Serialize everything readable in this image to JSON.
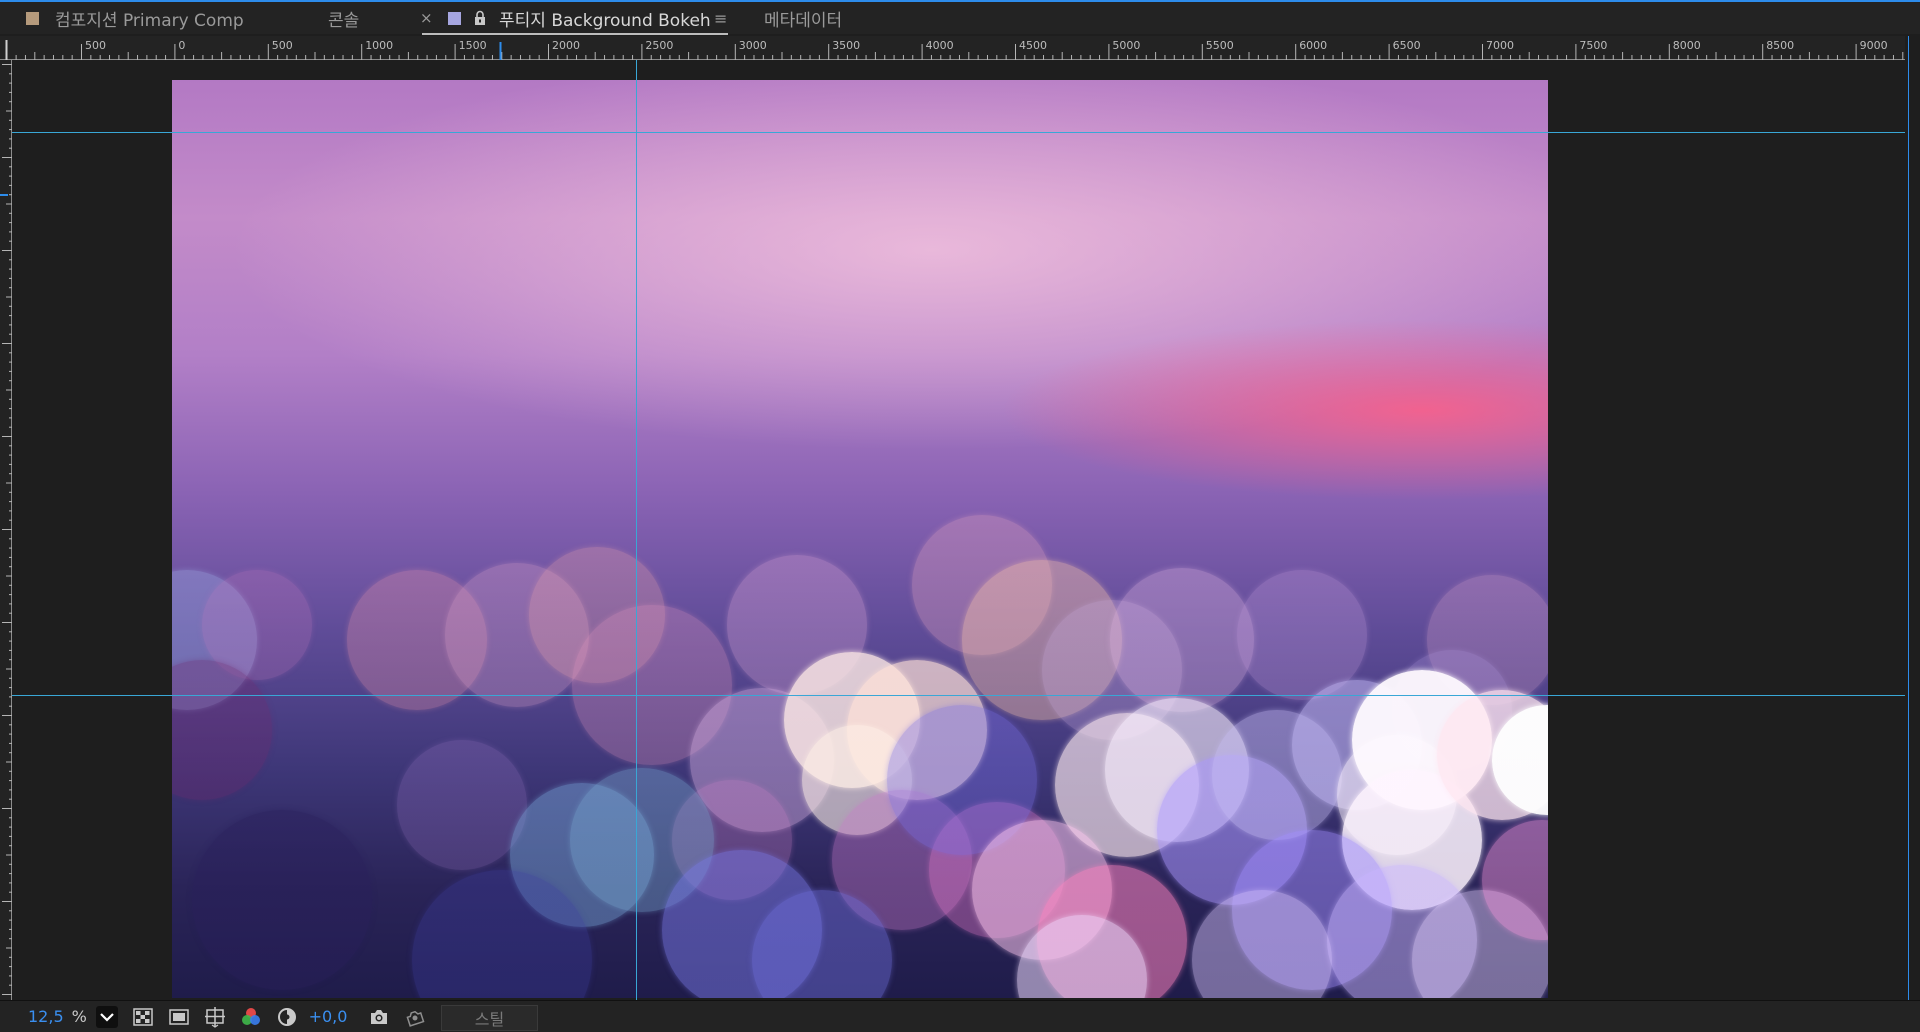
{
  "tabs": [
    {
      "label": "컴포지션 Primary Comp",
      "swatch_color": "#b59a7c"
    },
    {
      "label": "콘솔"
    },
    {
      "label": "푸티지 Background Bokeh",
      "swatch_color": "#a6a6e0",
      "active": true
    },
    {
      "label": "메타데이터"
    }
  ],
  "tab_close_symbol": "×",
  "tab_menu_symbol": "≡",
  "ruler_labels": [
    "500",
    "0",
    "500",
    "1000",
    "1500",
    "2000",
    "2500",
    "3000",
    "3500",
    "4000",
    "4500",
    "5000",
    "5500",
    "6000",
    "6500",
    "7000",
    "7500",
    "8000",
    "8500",
    "9000"
  ],
  "footer": {
    "zoom_value": "12,5",
    "zoom_unit": "%",
    "exposure_value": "+0,0",
    "still_label": "스틸"
  },
  "icons": [
    "lock-icon",
    "chevron-down-icon",
    "checkerboard-icon",
    "mask-icon",
    "grid-icon",
    "color-channels-icon",
    "reset-exposure-icon",
    "camera-icon",
    "show-snapshot-icon"
  ],
  "colors": {
    "accent_blue": "#2d8ceb",
    "guide": "#39a7d6",
    "pink_glow": "#ff5f87"
  }
}
